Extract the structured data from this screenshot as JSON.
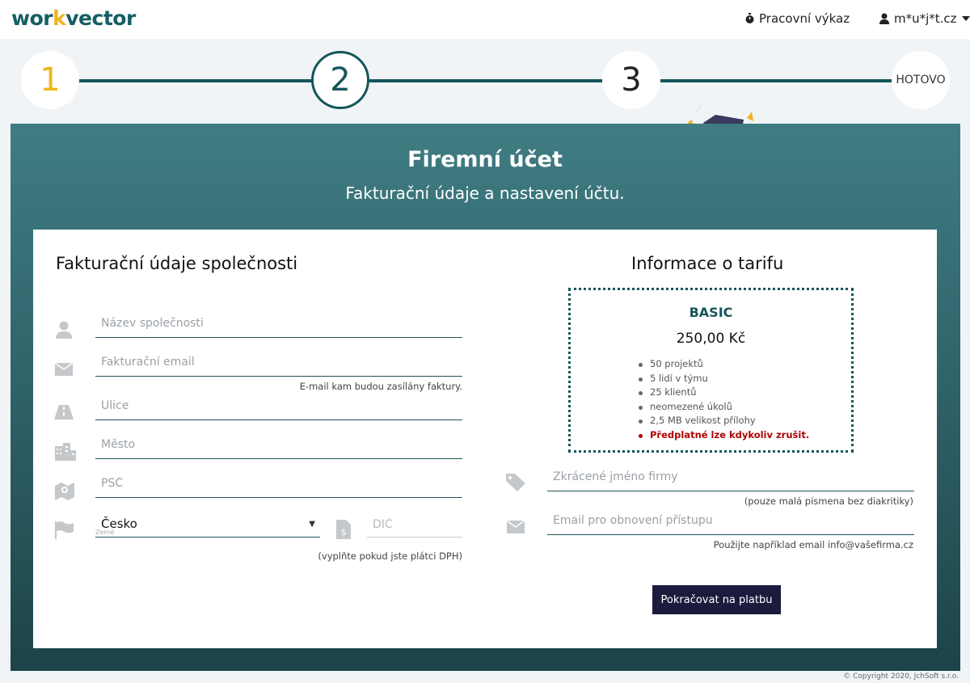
{
  "header": {
    "logo_prefix": "wor",
    "logo_accent": "k",
    "logo_suffix": "vector",
    "worklog_label": "Pracovní výkaz",
    "user_label": "m*u*j*t.cz",
    "worklog_icon": "stopwatch-icon",
    "user_icon": "user-icon",
    "dropdown_icon": "caret-down-icon"
  },
  "steps": [
    {
      "label": "1"
    },
    {
      "label": "2"
    },
    {
      "label": "3"
    },
    {
      "label": "HOTOVO"
    }
  ],
  "panel": {
    "title": "Firemní účet",
    "subtitle": "Fakturační údaje a nastavení účtu."
  },
  "billing": {
    "title": "Fakturační údaje společnosti",
    "company_placeholder": "Název společnosti",
    "email_placeholder": "Fakturační email",
    "email_hint": "E-mail kam budou zasílány faktury.",
    "street_placeholder": "Ulice",
    "city_placeholder": "Město",
    "zip_placeholder": "PSČ",
    "country_value": "Česko",
    "country_label": "Země",
    "dic_placeholder": "DIČ",
    "dic_hint": "(vyplňte pokud jste plátci DPH)"
  },
  "tariff": {
    "title": "Informace o tarifu",
    "name": "BASIC",
    "price": "250,00 Kč",
    "features": [
      "50 projektů",
      "5 lidí v týmu",
      "25 klientů",
      "neomezené úkolů",
      "2,5 MB velikost přílohy"
    ],
    "cancel_note": "Předplatné lze kdykoliv zrušit."
  },
  "account": {
    "shortname_placeholder": "Zkrácené jméno firmy",
    "shortname_hint": "(pouze malá písmena bez diakritiky)",
    "recovery_placeholder": "Email pro obnovení přístupu",
    "recovery_hint": "Použijte například email info@vašefirma.cz"
  },
  "actions": {
    "continue_label": "Pokračovat na platbu"
  },
  "footer": {
    "copyright": "© Copyright 2020, JchSoft s.r.o."
  },
  "colors": {
    "brand": "#15565a",
    "accent": "#f0b51e",
    "button": "#1c1a3d",
    "warning": "#b00000"
  }
}
